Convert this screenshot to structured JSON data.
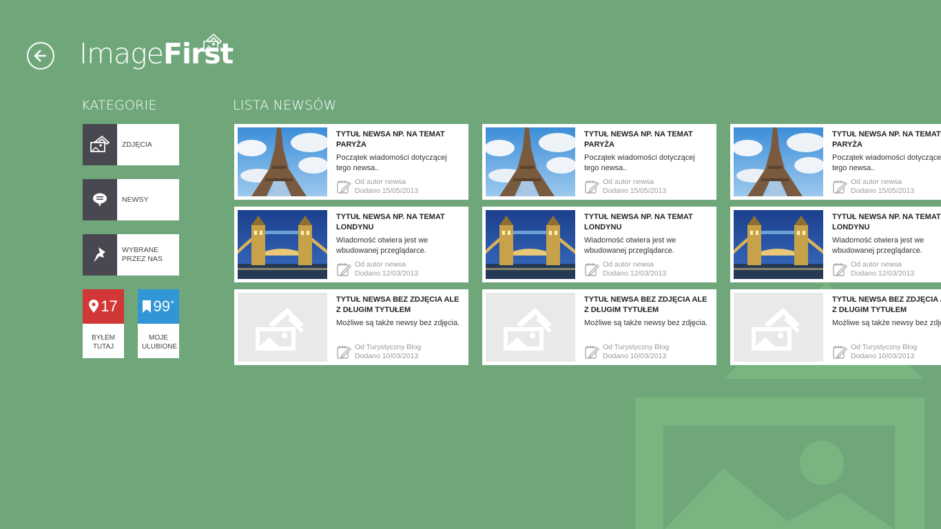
{
  "app": {
    "title_light": "Image",
    "title_bold": "First"
  },
  "sections": {
    "categories": "KATEGORIE",
    "news": "LISTA NEWSÓW"
  },
  "categories": [
    {
      "label": "ZDJĘCIA",
      "icon": "image-icon"
    },
    {
      "label": "NEWSY",
      "icon": "speech-bubble-icon"
    },
    {
      "label": "WYBRANE PRZEZ NAS",
      "icon": "pin-icon"
    }
  ],
  "counters": {
    "visited": {
      "count": "17",
      "label": "BYŁEM TUTAJ",
      "color": "#d23737",
      "icon": "location-pin-icon"
    },
    "favorites": {
      "count": "99",
      "suffix": "+",
      "label": "MOJE ULUBIONE",
      "color": "#3196d6",
      "icon": "bookmark-icon"
    }
  },
  "news_columns": [
    [
      {
        "title": "TYTUŁ NEWSA NP. NA TEMAT PARYŻA",
        "excerpt": "Początek wiadomości dotyczącej tego newsa..",
        "author": "Od autor newsa",
        "date": "Dodano 15/05/2013",
        "image": "eiffel-tower"
      },
      {
        "title": "TYTUŁ NEWSA NP. NA TEMAT LONDYNU",
        "excerpt": "Wiadomość otwiera jest we wbudowanej przeglądarce.",
        "author": "Od autor newsa",
        "date": "Dodano 12/03/2013",
        "image": "tower-bridge"
      },
      {
        "title": "TYTUŁ NEWSA BEZ ZDJĘCIA ALE Z DŁUGIM TYTUŁEM",
        "excerpt": "Możliwe są także newsy bez zdjęcia.",
        "author": "Od Turystyczny Blog",
        "date": "Dodano 10/03/2013",
        "image": "placeholder"
      }
    ],
    [
      {
        "title": "TYTUŁ NEWSA NP. NA TEMAT PARYŻA",
        "excerpt": "Początek wiadomości dotyczącej tego newsa..",
        "author": "Od autor newsa",
        "date": "Dodano 15/05/2013",
        "image": "eiffel-tower"
      },
      {
        "title": "TYTUŁ NEWSA NP. NA TEMAT LONDYNU",
        "excerpt": "Wiadomość otwiera jest we wbudowanej przeglądarce.",
        "author": "Od autor newsa",
        "date": "Dodano 12/03/2013",
        "image": "tower-bridge"
      },
      {
        "title": "TYTUŁ NEWSA BEZ ZDJĘCIA ALE Z DŁUGIM TYTUŁEM",
        "excerpt": "Możliwe są także newsy bez zdjęcia.",
        "author": "Od Turystyczny Blog",
        "date": "Dodano 10/03/2013",
        "image": "placeholder"
      }
    ],
    [
      {
        "title": "TYTUŁ NEWSA NP. NA TEMAT PARYŻA",
        "excerpt": "Początek wiadomości dotyczącej tego newsa..",
        "author": "Od autor newsa",
        "date": "Dodano 15/05/2013",
        "image": "eiffel-tower"
      },
      {
        "title": "TYTUŁ NEWSA NP. NA TEMAT LONDYNU",
        "excerpt": "Wiadomość otwiera jest we wbudowanej przeglądarce.",
        "author": "Od autor newsa",
        "date": "Dodano 12/03/2013",
        "image": "tower-bridge"
      },
      {
        "title": "TYTUŁ NEWSA BEZ ZDJĘCIA ALE Z DŁUGIM TYTUŁEM",
        "excerpt": "Możliwe są także newsy bez zdjęcia.",
        "author": "Od Turystyczny Blog",
        "date": "Dodano 10/03/2013",
        "image": "placeholder"
      }
    ]
  ],
  "colors": {
    "background": "#6fa77b",
    "category_icon_bg": "#49474f",
    "watermark": "#7bb883"
  }
}
